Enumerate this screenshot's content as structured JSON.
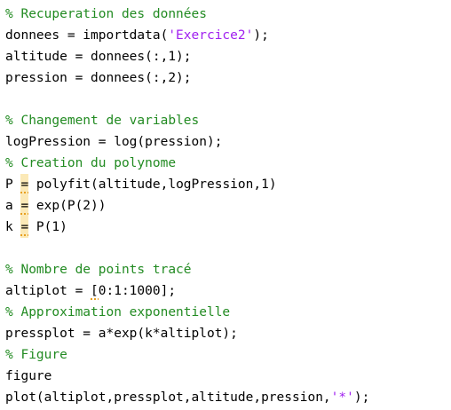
{
  "editor": {
    "lines": [
      {
        "type": "comment",
        "text": "% Recuperation des données"
      },
      {
        "type": "string_line",
        "before": "donnees = importdata(",
        "string": "'Exercice2'",
        "after": ");"
      },
      {
        "type": "code",
        "text": "altitude = donnees(:,1);"
      },
      {
        "type": "code",
        "text": "pression = donnees(:,2);"
      },
      {
        "type": "blank",
        "text": ""
      },
      {
        "type": "comment",
        "text": "% Changement de variables"
      },
      {
        "type": "code",
        "text": "logPression = log(pression);"
      },
      {
        "type": "comment",
        "text": "% Creation du polynome"
      },
      {
        "type": "warn_line",
        "before": "P ",
        "mark": "=",
        "after": " polyfit(altitude,logPression,1)"
      },
      {
        "type": "warn_line",
        "before": "a ",
        "mark": "=",
        "after": " exp(P(2))"
      },
      {
        "type": "warn_line",
        "before": "k ",
        "mark": "=",
        "after": " P(1)"
      },
      {
        "type": "blank",
        "text": ""
      },
      {
        "type": "comment",
        "text": "% Nombre de points tracé"
      },
      {
        "type": "underline_line",
        "before": "altiplot = ",
        "mark": "[",
        "after": "0:1:1000];"
      },
      {
        "type": "comment",
        "text": "% Approximation exponentielle"
      },
      {
        "type": "code",
        "text": "pressplot = a*exp(k*altiplot);"
      },
      {
        "type": "comment",
        "text": "% Figure"
      },
      {
        "type": "code",
        "text": "figure"
      },
      {
        "type": "string_line",
        "before": "plot(altiplot,pressplot,altitude,pression,",
        "string": "'*'",
        "after": ");"
      }
    ]
  },
  "colors": {
    "comment": "#228b22",
    "string": "#a020f0",
    "warning_underline": "#e8a020",
    "warning_highlight": "#fbe9b7"
  }
}
